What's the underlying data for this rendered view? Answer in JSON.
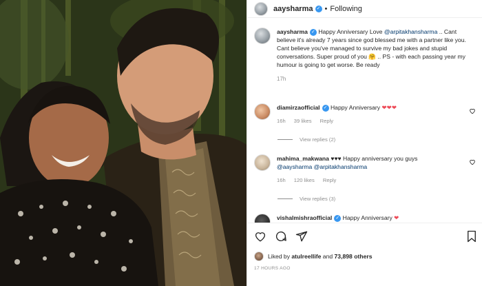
{
  "post": {
    "username": "aaysharma",
    "separator": "•",
    "follow_status": "Following",
    "verified_mark": "✓",
    "caption": {
      "text_1": "Happy Anniversary Love ",
      "mention": "@arpitakhansharma",
      "text_2": " .. Cant believe it's already 7 years since god blessed me with a partner like you. Cant believe you've managed to survive my bad jokes and stupid conversations. Super proud of you ",
      "emoji": "🤗",
      "text_3": " .. PS - with each passing year my humour is going to get worse. Be ready",
      "age": "17h"
    },
    "comments": [
      {
        "username": "diamirzaofficial",
        "text": "Happy Anniversary",
        "hearts": "❤❤❤",
        "age": "16h",
        "likes": "39 likes",
        "reply": "Reply",
        "view_replies": "View replies (2)"
      },
      {
        "username": "mahima_makwana",
        "hearts": "♥♥♥",
        "text": " Happy anniversary you guys",
        "mention_1": "@aaysharma",
        "mention_2": "@arpitakhansharma",
        "age": "16h",
        "likes": "120 likes",
        "reply": "Reply",
        "view_replies": "View replies (3)"
      },
      {
        "username": "vishalmishraofficial",
        "text": "Happy Anniversary",
        "hearts": "❤"
      }
    ],
    "liked_by": {
      "prefix": "Liked by ",
      "user": "atulreellife",
      "middle": " and ",
      "others": "73,898 others"
    },
    "timestamp": "17 HOURS AGO",
    "icons": [
      "heart-icon",
      "comment-icon",
      "share-icon",
      "bookmark-icon",
      "like-comment-icon"
    ]
  },
  "colors": {
    "link": "#00376b",
    "verified": "#3897f0",
    "muted": "#8e8e8e",
    "heart": "#ed4956"
  }
}
